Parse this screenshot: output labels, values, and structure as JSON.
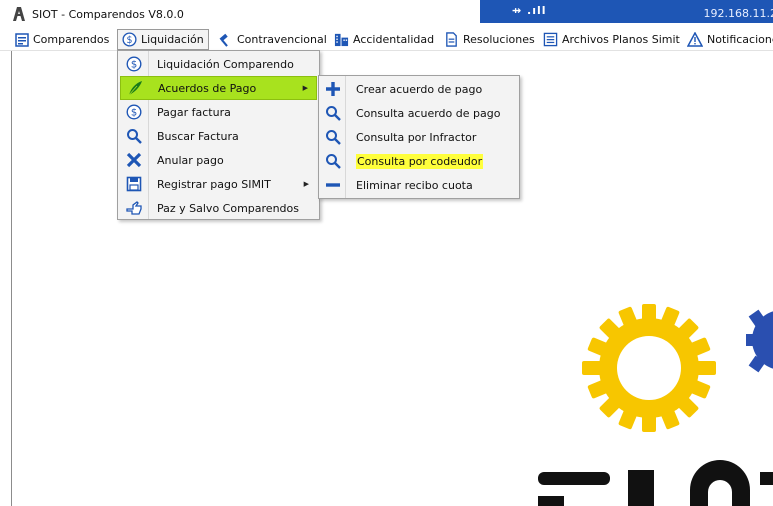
{
  "window": {
    "title": "SIOT - Comparendos V8.0.0",
    "signal": "⇸ .ıll",
    "ip": "192.168.11.2"
  },
  "menubar": {
    "items": [
      {
        "label": "Comparendos",
        "icon": "document-list-icon"
      },
      {
        "label": "Liquidación",
        "icon": "dollar-circle-icon",
        "active": true
      },
      {
        "label": "Contravencional",
        "icon": "gavel-icon"
      },
      {
        "label": "Accidentalidad",
        "icon": "building-icon"
      },
      {
        "label": "Resoluciones",
        "icon": "document-icon"
      },
      {
        "label": "Archivos Planos Simit",
        "icon": "list-file-icon"
      },
      {
        "label": "Notificaciones",
        "icon": "warning-icon"
      }
    ]
  },
  "liquidacion_menu": {
    "items": [
      {
        "label": "Liquidación Comparendo",
        "icon": "dollar-circle-icon"
      },
      {
        "label": "Acuerdos de Pago",
        "icon": "feather-icon",
        "has_submenu": true,
        "highlighted": true
      },
      {
        "label": "Pagar factura",
        "icon": "dollar-circle-icon"
      },
      {
        "label": "Buscar Factura",
        "icon": "search-icon"
      },
      {
        "label": "Anular pago",
        "icon": "x-icon"
      },
      {
        "label": "Registrar pago SIMIT",
        "icon": "save-icon",
        "has_submenu": true
      },
      {
        "label": "Paz y Salvo Comparendos",
        "icon": "hand-icon"
      }
    ]
  },
  "acuerdos_submenu": {
    "items": [
      {
        "label": "Crear acuerdo de pago",
        "icon": "plus-icon"
      },
      {
        "label": "Consulta acuerdo de pago",
        "icon": "search-icon"
      },
      {
        "label": "Consulta por Infractor",
        "icon": "search-icon"
      },
      {
        "label": "Consulta por codeudor",
        "icon": "search-icon",
        "text_highlight": "#ffff3c"
      },
      {
        "label": "Eliminar recibo cuota",
        "icon": "minus-icon"
      }
    ]
  },
  "logo": {
    "text": "SIOT"
  },
  "colors": {
    "accent_blue": "#1e56b5",
    "menu_highlight_green": "#a8e21e",
    "text_highlight_yellow": "#ffff3c",
    "logo_gear_yellow": "#f7c600",
    "logo_gear_blue": "#2a4fb0"
  }
}
